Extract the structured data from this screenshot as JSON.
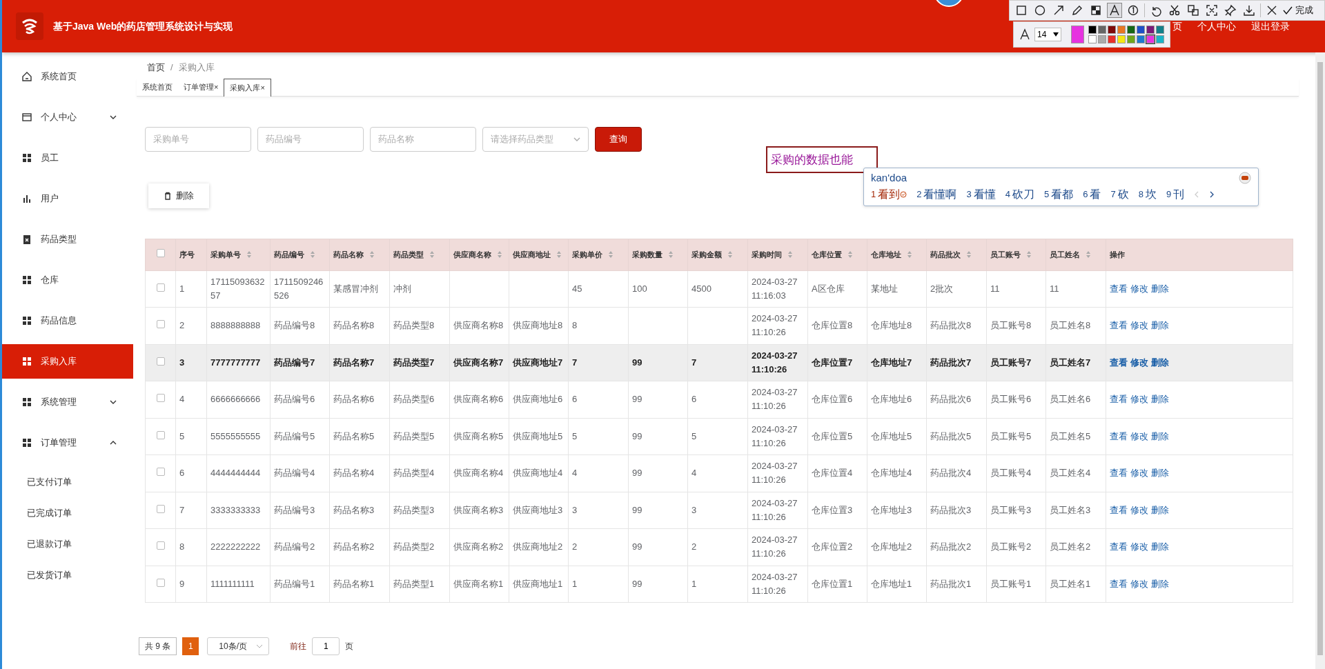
{
  "header": {
    "title": "基于Java Web的药店管理系统设计与实现",
    "nav": [
      "页",
      "个人中心",
      "退出登录"
    ]
  },
  "sidebar": {
    "items": [
      {
        "label": "系统首页",
        "kind": "home",
        "selected": false
      },
      {
        "label": "个人中心",
        "kind": "card",
        "selected": false,
        "expanded": false
      },
      {
        "label": "员工",
        "kind": "grid",
        "selected": false
      },
      {
        "label": "用户",
        "kind": "chart",
        "selected": false
      },
      {
        "label": "药品类型",
        "kind": "clipboard",
        "selected": false
      },
      {
        "label": "仓库",
        "kind": "grid",
        "selected": false
      },
      {
        "label": "药品信息",
        "kind": "grid",
        "selected": false
      },
      {
        "label": "采购入库",
        "kind": "grid",
        "selected": true
      },
      {
        "label": "系统管理",
        "kind": "grid",
        "selected": false,
        "expanded": false
      },
      {
        "label": "订单管理",
        "kind": "grid",
        "selected": false,
        "expanded": true,
        "children": [
          {
            "label": "已支付订单"
          },
          {
            "label": "已完成订单"
          },
          {
            "label": "已退款订单"
          },
          {
            "label": "已发货订单"
          }
        ]
      }
    ]
  },
  "breadcrumb": [
    "首页",
    "/",
    "采购入库"
  ],
  "tabs": [
    {
      "label": "系统首页",
      "selected": false
    },
    {
      "label": "订单管理",
      "close": "×",
      "selected": false
    },
    {
      "label": "采购入库",
      "close": "×",
      "selected": true
    }
  ],
  "filters": {
    "fields": [
      {
        "placeholder": "采购单号"
      },
      {
        "placeholder": "药品编号"
      },
      {
        "placeholder": "药品名称"
      }
    ],
    "select": {
      "placeholder": "请选择药品类型"
    },
    "search_button": "查询"
  },
  "delete_button": "删除",
  "table": {
    "select_all": {
      "checked": false
    },
    "columns": [
      {
        "label": "序号",
        "sortable": false
      },
      {
        "label": "采购单号",
        "sortable": true
      },
      {
        "label": "药品编号",
        "sortable": true
      },
      {
        "label": "药品名称",
        "sortable": true
      },
      {
        "label": "药品类型",
        "sortable": true
      },
      {
        "label": "供应商名称",
        "sortable": true
      },
      {
        "label": "供应商地址",
        "sortable": true
      },
      {
        "label": "采购单价",
        "sortable": true
      },
      {
        "label": "采购数量",
        "sortable": true
      },
      {
        "label": "采购金额",
        "sortable": true
      },
      {
        "label": "采购时间",
        "sortable": true
      },
      {
        "label": "仓库位置",
        "sortable": true
      },
      {
        "label": "仓库地址",
        "sortable": true
      },
      {
        "label": "药品批次",
        "sortable": true
      },
      {
        "label": "员工账号",
        "sortable": true
      },
      {
        "label": "员工姓名",
        "sortable": true
      },
      {
        "label": "操作",
        "sortable": false
      }
    ],
    "rows": [
      {
        "checked": false,
        "highlighted": false,
        "cells": [
          "1",
          "1711509363257",
          "1711509246526",
          "某感冒冲剂",
          "冲剂",
          "",
          "",
          "45",
          "100",
          "4500",
          "2024-03-27 11:16:03",
          "A区仓库",
          "某地址",
          "2批次",
          "11",
          "11"
        ],
        "actions": [
          "查看",
          "修改",
          "删除"
        ]
      },
      {
        "checked": false,
        "highlighted": false,
        "cells": [
          "2",
          "8888888888",
          "药品编号8",
          "药品名称8",
          "药品类型8",
          "供应商名称8",
          "供应商地址8",
          "8",
          "",
          "",
          "2024-03-27 11:10:26",
          "仓库位置8",
          "仓库地址8",
          "药品批次8",
          "员工账号8",
          "员工姓名8"
        ],
        "actions": [
          "查看",
          "修改",
          "删除"
        ]
      },
      {
        "checked": false,
        "highlighted": true,
        "cells": [
          "3",
          "7777777777",
          "药品编号7",
          "药品名称7",
          "药品类型7",
          "供应商名称7",
          "供应商地址7",
          "7",
          "99",
          "7",
          "2024-03-27 11:10:26",
          "仓库位置7",
          "仓库地址7",
          "药品批次7",
          "员工账号7",
          "员工姓名7"
        ],
        "actions": [
          "查看",
          "修改",
          "删除"
        ]
      },
      {
        "checked": false,
        "highlighted": false,
        "cells": [
          "4",
          "6666666666",
          "药品编号6",
          "药品名称6",
          "药品类型6",
          "供应商名称6",
          "供应商地址6",
          "6",
          "99",
          "6",
          "2024-03-27 11:10:26",
          "仓库位置6",
          "仓库地址6",
          "药品批次6",
          "员工账号6",
          "员工姓名6"
        ],
        "actions": [
          "查看",
          "修改",
          "删除"
        ]
      },
      {
        "checked": false,
        "highlighted": false,
        "cells": [
          "5",
          "5555555555",
          "药品编号5",
          "药品名称5",
          "药品类型5",
          "供应商名称5",
          "供应商地址5",
          "5",
          "99",
          "5",
          "2024-03-27 11:10:26",
          "仓库位置5",
          "仓库地址5",
          "药品批次5",
          "员工账号5",
          "员工姓名5"
        ],
        "actions": [
          "查看",
          "修改",
          "删除"
        ]
      },
      {
        "checked": false,
        "highlighted": false,
        "cells": [
          "6",
          "4444444444",
          "药品编号4",
          "药品名称4",
          "药品类型4",
          "供应商名称4",
          "供应商地址4",
          "4",
          "99",
          "4",
          "2024-03-27 11:10:26",
          "仓库位置4",
          "仓库地址4",
          "药品批次4",
          "员工账号4",
          "员工姓名4"
        ],
        "actions": [
          "查看",
          "修改",
          "删除"
        ]
      },
      {
        "checked": false,
        "highlighted": false,
        "cells": [
          "7",
          "3333333333",
          "药品编号3",
          "药品名称3",
          "药品类型3",
          "供应商名称3",
          "供应商地址3",
          "3",
          "99",
          "3",
          "2024-03-27 11:10:26",
          "仓库位置3",
          "仓库地址3",
          "药品批次3",
          "员工账号3",
          "员工姓名3"
        ],
        "actions": [
          "查看",
          "修改",
          "删除"
        ]
      },
      {
        "checked": false,
        "highlighted": false,
        "cells": [
          "8",
          "2222222222",
          "药品编号2",
          "药品名称2",
          "药品类型2",
          "供应商名称2",
          "供应商地址2",
          "2",
          "99",
          "2",
          "2024-03-27 11:10:26",
          "仓库位置2",
          "仓库地址2",
          "药品批次2",
          "员工账号2",
          "员工姓名2"
        ],
        "actions": [
          "查看",
          "修改",
          "删除"
        ]
      },
      {
        "checked": false,
        "highlighted": false,
        "cells": [
          "9",
          "1111111111",
          "药品编号1",
          "药品名称1",
          "药品类型1",
          "供应商名称1",
          "供应商地址1",
          "1",
          "99",
          "1",
          "2024-03-27 11:10:26",
          "仓库位置1",
          "仓库地址1",
          "药品批次1",
          "员工账号1",
          "员工姓名1"
        ],
        "actions": [
          "查看",
          "修改",
          "删除"
        ]
      }
    ]
  },
  "pagination": {
    "total": "共 9 条",
    "pages": [
      {
        "label": "1",
        "selected": true
      }
    ],
    "page_size": "10条/页",
    "goto": "前往",
    "page_input": "1",
    "page_suffix": "页"
  },
  "screenshot_tool": {
    "tools": [
      {
        "kind": "rect",
        "selected": false
      },
      {
        "kind": "ellipse",
        "selected": false
      },
      {
        "kind": "arrow",
        "selected": false
      },
      {
        "kind": "pen",
        "selected": false
      },
      {
        "kind": "mosaic",
        "selected": false
      },
      {
        "kind": "text",
        "selected": true
      },
      {
        "kind": "number",
        "selected": false
      },
      {
        "kind": "undo",
        "selected": false
      },
      {
        "kind": "cut",
        "selected": false
      },
      {
        "kind": "translate",
        "selected": false
      },
      {
        "kind": "ocr",
        "selected": false
      },
      {
        "kind": "pin",
        "selected": false
      },
      {
        "kind": "download",
        "selected": false
      },
      {
        "kind": "close",
        "selected": false
      }
    ],
    "done_label": "完成",
    "font_size": "14",
    "palette": [
      {
        "color": "#000000",
        "selected": false
      },
      {
        "color": "#666666",
        "selected": false
      },
      {
        "color": "#7f0a0a",
        "selected": false
      },
      {
        "color": "#e87722",
        "selected": false
      },
      {
        "color": "#166616",
        "selected": false
      },
      {
        "color": "#1f4fc8",
        "selected": false
      },
      {
        "color": "#7a1a7a",
        "selected": false
      },
      {
        "color": "#137f8a",
        "selected": false
      },
      {
        "color": "#ffffff",
        "selected": false
      },
      {
        "color": "#aaaaaa",
        "selected": false
      },
      {
        "color": "#e8302a",
        "selected": false
      },
      {
        "color": "#f5e614",
        "selected": false
      },
      {
        "color": "#6fa61c",
        "selected": false
      },
      {
        "color": "#1e78d0",
        "selected": false
      },
      {
        "color": "#e633e0",
        "selected": true
      },
      {
        "color": "#1ab4c8",
        "selected": false
      }
    ]
  },
  "annotation": {
    "text": "采购的数据也能"
  },
  "ime": {
    "input": "kan'doa",
    "candidates": [
      {
        "index": "1",
        "text": "看到",
        "selected": true
      },
      {
        "index": "2",
        "text": "看懂啊",
        "selected": false
      },
      {
        "index": "3",
        "text": "看懂",
        "selected": false
      },
      {
        "index": "4",
        "text": "砍刀",
        "selected": false
      },
      {
        "index": "5",
        "text": "看都",
        "selected": false
      },
      {
        "index": "6",
        "text": "看",
        "selected": false
      },
      {
        "index": "7",
        "text": "砍",
        "selected": false
      },
      {
        "index": "8",
        "text": "坎",
        "selected": false
      },
      {
        "index": "9",
        "text": "刊",
        "selected": false
      }
    ]
  }
}
